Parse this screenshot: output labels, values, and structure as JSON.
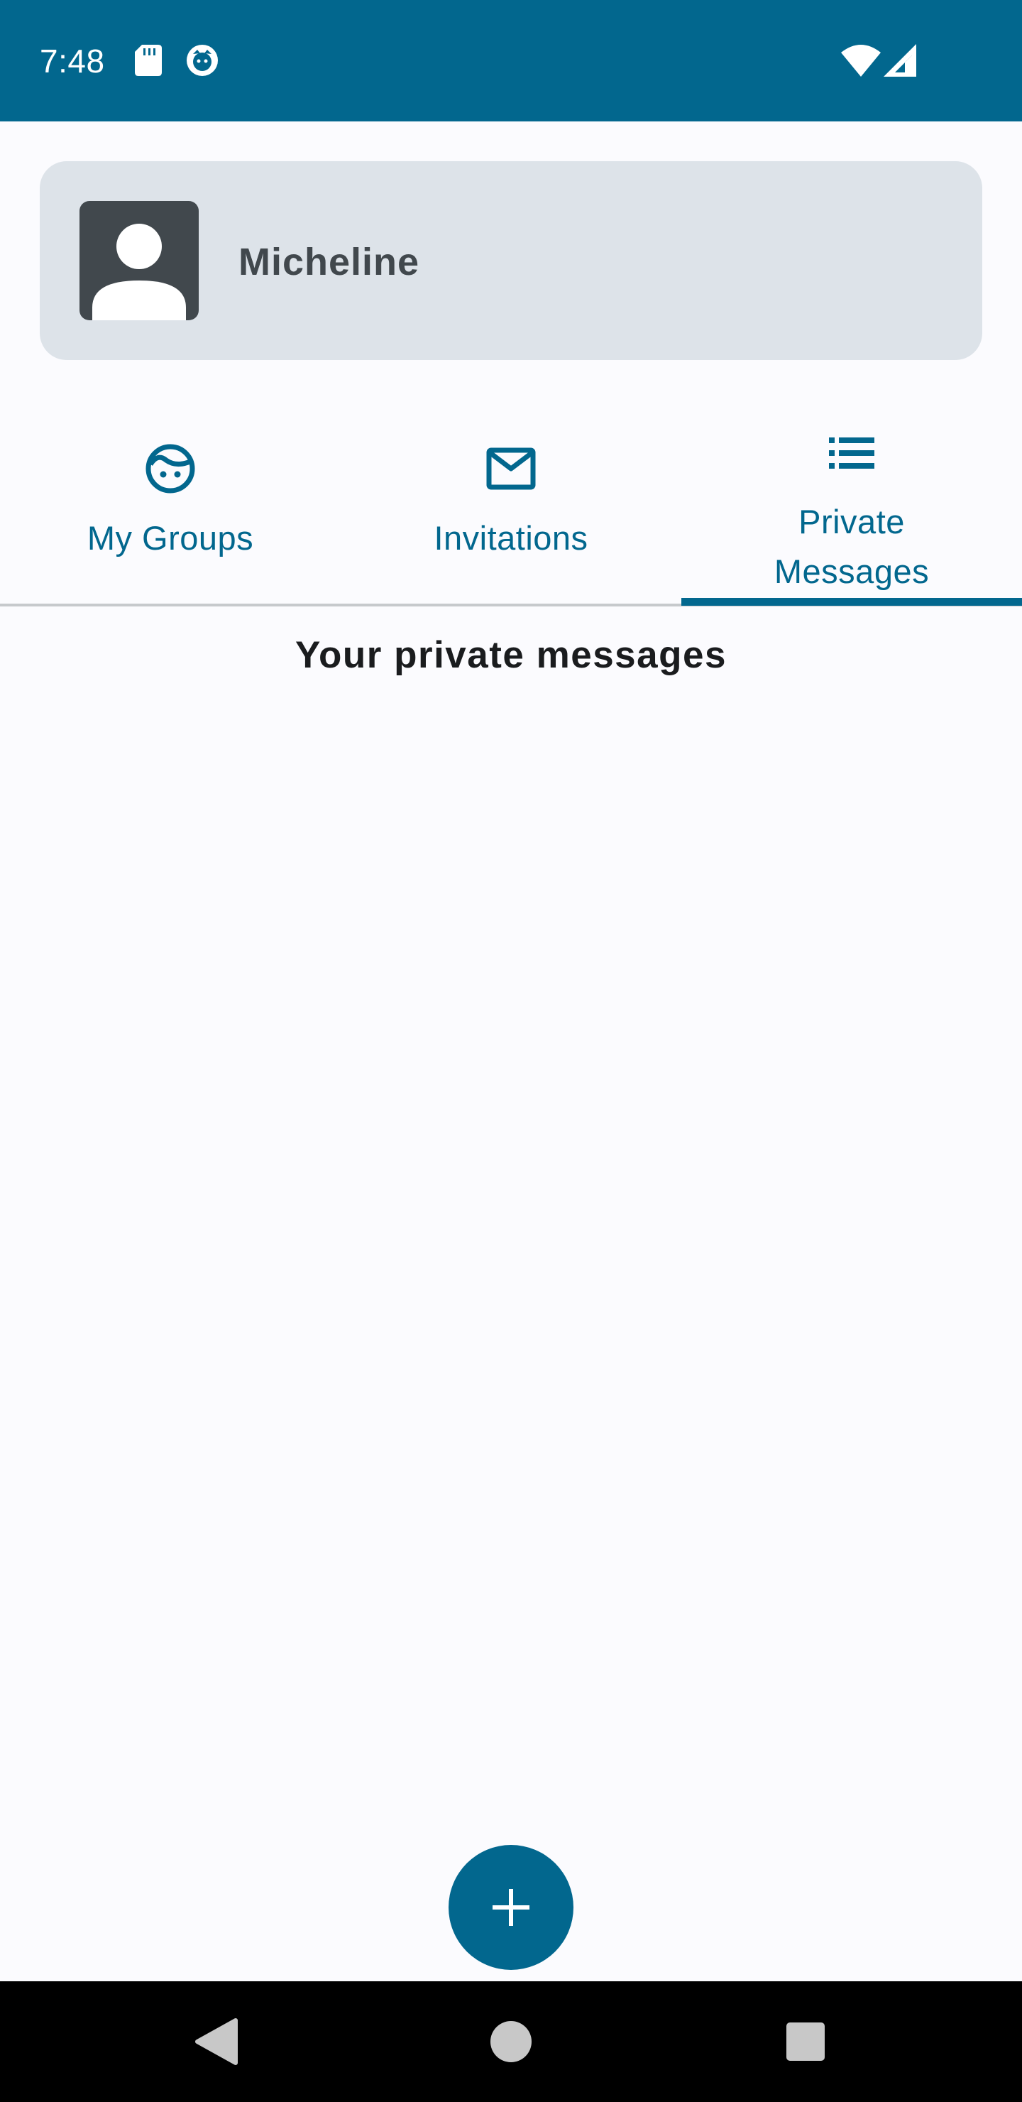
{
  "status_bar": {
    "time": "7:48",
    "icons": [
      "sd-card-icon",
      "notification-app-icon",
      "wifi-icon",
      "signal-icon"
    ],
    "color": "#02678e"
  },
  "profile": {
    "name": "Micheline",
    "avatar_icon": "person-icon"
  },
  "tabs": [
    {
      "label": "My Groups",
      "icon": "face-icon",
      "selected": false
    },
    {
      "label": "Invitations",
      "icon": "mail-icon",
      "selected": false
    },
    {
      "label_line1": "Private",
      "label_line2": "Messages",
      "icon": "list-icon",
      "selected": true
    }
  ],
  "main": {
    "title": "Your private messages"
  },
  "fab": {
    "icon": "plus-icon"
  },
  "nav_bar": {
    "buttons": [
      "back-icon",
      "home-icon",
      "recents-icon"
    ]
  },
  "colors": {
    "primary": "#02678e",
    "card_bg": "#dde3e9",
    "avatar_bg": "#41484d",
    "background": "#fbfbfe"
  }
}
